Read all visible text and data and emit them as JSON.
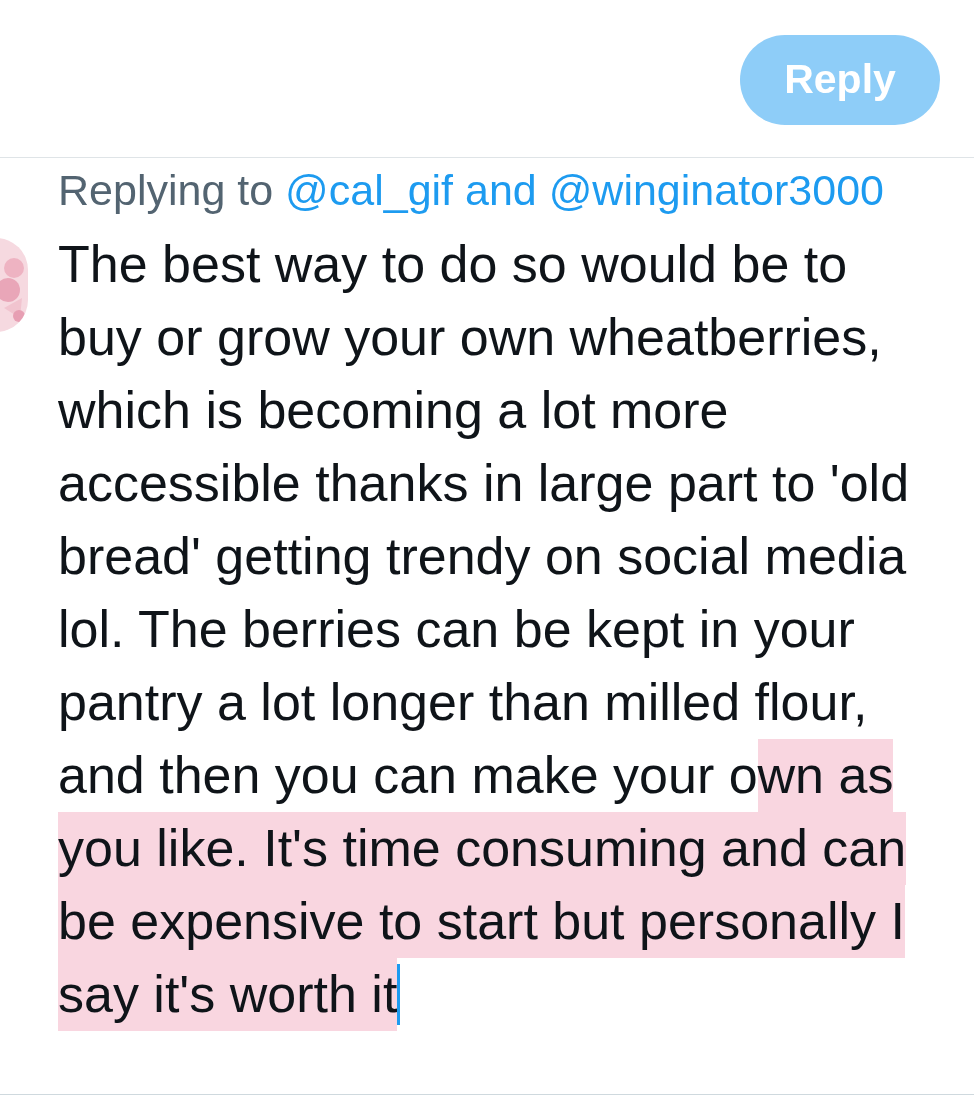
{
  "reply_button": {
    "label": "Reply"
  },
  "replying_to": {
    "label": "Replying to",
    "mentions": "@cal_gif and @winginator3000"
  },
  "reply_text": {
    "caret_visible": true,
    "lines": [
      [
        {
          "text": "The best way to do so would be to",
          "selected": false
        }
      ],
      [
        {
          "text": "buy or grow your own wheatberries,",
          "selected": false
        }
      ],
      [
        {
          "text": "which is becoming a lot more",
          "selected": false
        }
      ],
      [
        {
          "text": "accessible thanks in large part to 'old",
          "selected": false
        }
      ],
      [
        {
          "text": "bread' getting trendy on social media",
          "selected": false
        }
      ],
      [
        {
          "text": "lol. The berries can be kept in your",
          "selected": false
        }
      ],
      [
        {
          "text": "pantry a lot longer than milled flour,",
          "selected": false
        }
      ],
      [
        {
          "text": "and then you can make your o",
          "selected": false
        },
        {
          "text": "wn as",
          "selected": true
        }
      ],
      [
        {
          "text": "you like. It's time consuming and can",
          "selected": true
        }
      ],
      [
        {
          "text": "be expensive to start but personally I",
          "selected": true
        }
      ],
      [
        {
          "text": "say it's worth it",
          "selected": true
        }
      ]
    ]
  }
}
